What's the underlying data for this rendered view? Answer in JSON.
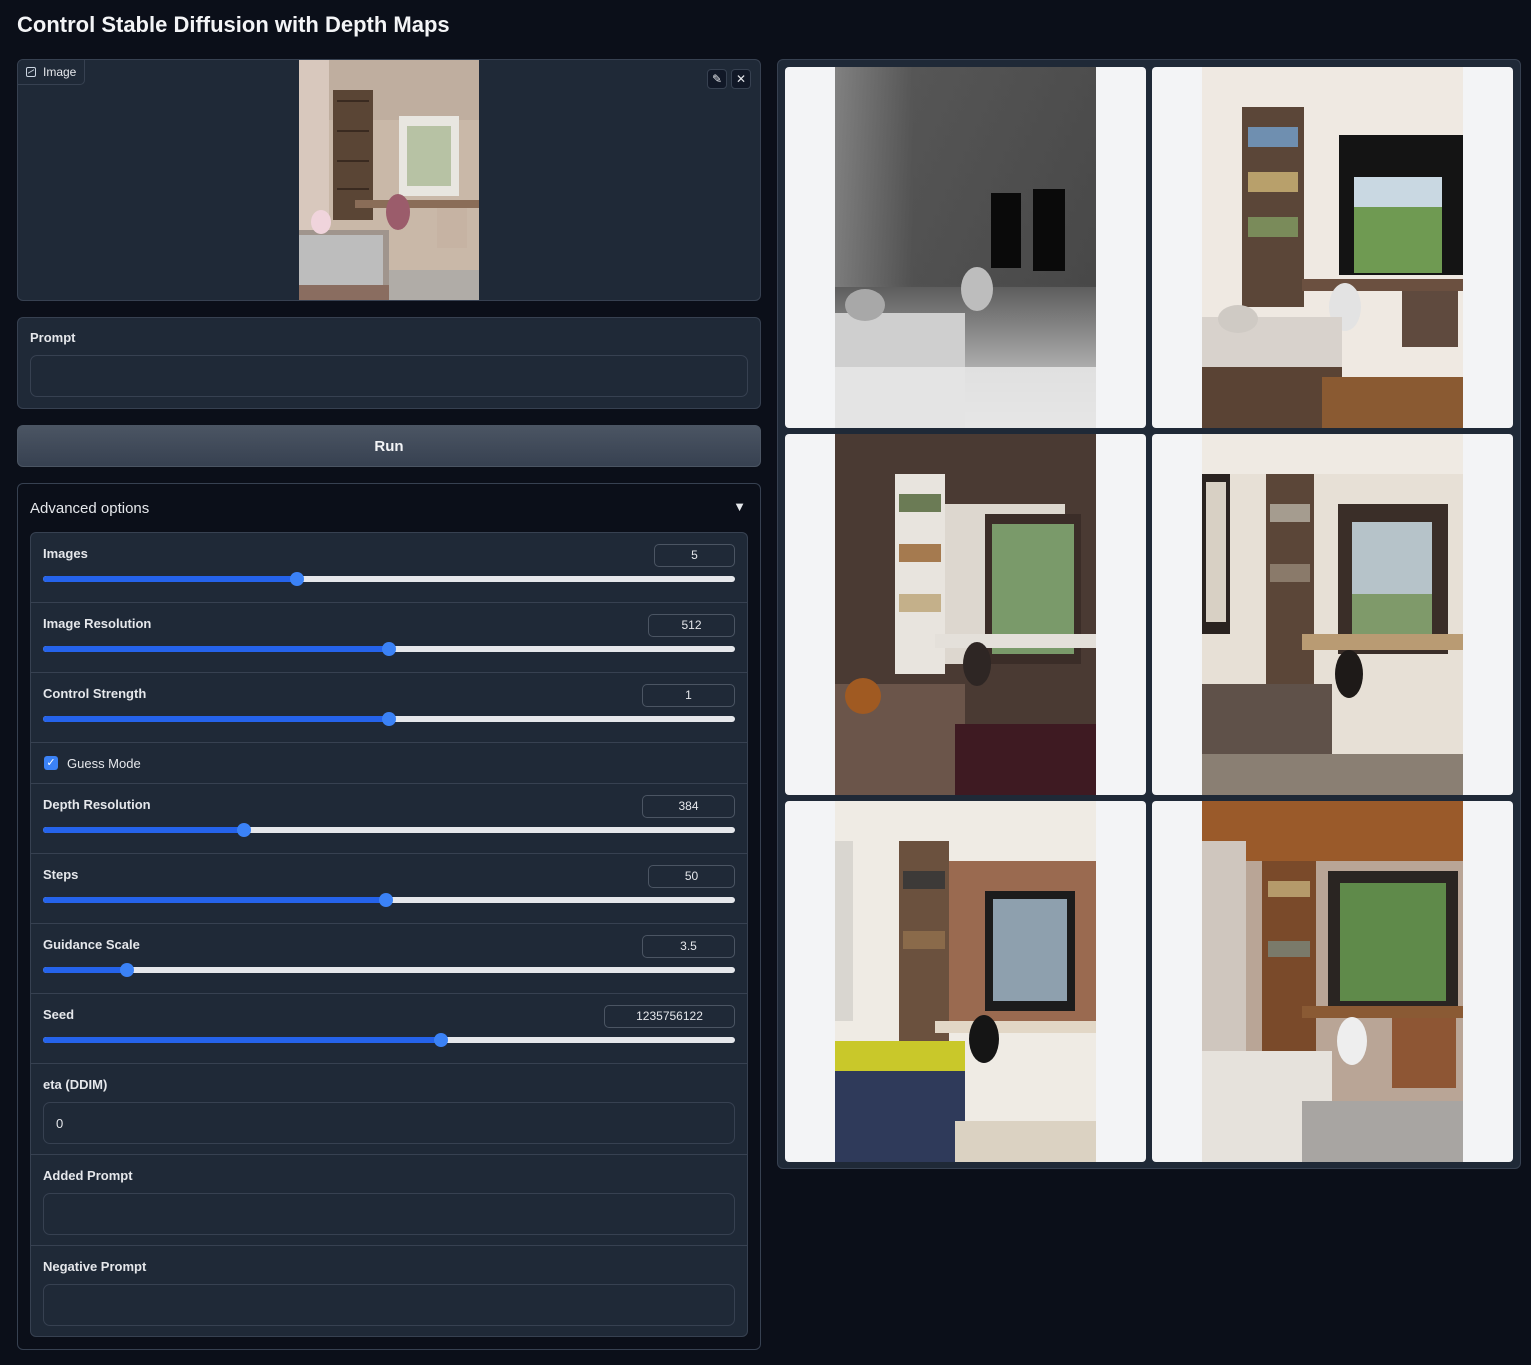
{
  "title": "Control Stable Diffusion with Depth Maps",
  "image_input": {
    "label": "Image",
    "edit_icon": "pencil-icon",
    "clear_icon": "close-icon"
  },
  "prompt": {
    "label": "Prompt",
    "value": "",
    "placeholder": ""
  },
  "run_label": "Run",
  "advanced": {
    "label": "Advanced options",
    "toggle_icon": "triangle-down-icon",
    "sliders": {
      "images": {
        "label": "Images",
        "value": "5",
        "fraction": 0.367
      },
      "image_resolution": {
        "label": "Image Resolution",
        "value": "512",
        "fraction": 0.5
      },
      "control_strength": {
        "label": "Control Strength",
        "value": "1",
        "fraction": 0.5
      },
      "depth_resolution": {
        "label": "Depth Resolution",
        "value": "384",
        "fraction": 0.291
      },
      "steps": {
        "label": "Steps",
        "value": "50",
        "fraction": 0.496
      },
      "guidance_scale": {
        "label": "Guidance Scale",
        "value": "3.5",
        "fraction": 0.122
      },
      "seed": {
        "label": "Seed",
        "value": "1235756122",
        "fraction": 0.575
      }
    },
    "guess_mode": {
      "label": "Guess Mode",
      "checked": true
    },
    "eta": {
      "label": "eta (DDIM)",
      "value": "0"
    },
    "added_prompt": {
      "label": "Added Prompt",
      "value": ""
    },
    "negative_prompt": {
      "label": "Negative Prompt",
      "value": ""
    }
  },
  "gallery": {
    "items": [
      "depth-map-image",
      "generated-bedroom-1",
      "generated-bedroom-2",
      "generated-bedroom-3",
      "generated-bedroom-4",
      "generated-bedroom-5"
    ]
  },
  "colors": {
    "background": "#0b0f19",
    "panel": "#1f2937",
    "border": "#374151",
    "accent": "#3b82f6"
  }
}
